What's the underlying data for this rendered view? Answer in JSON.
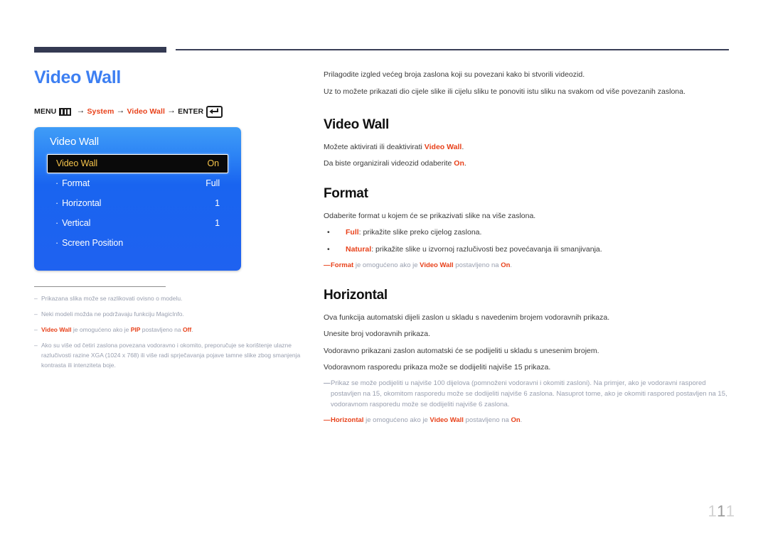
{
  "page": {
    "title": "Video Wall",
    "number": "111",
    "number_digits": [
      "1",
      "1",
      "1"
    ]
  },
  "colors": {
    "title_blue": "#3d7ff2",
    "accent_red": "#e8411a",
    "osd_blue": "#1964f0",
    "osd_highlight_text": "#f5c34a",
    "rule_dark": "#343a52",
    "note_gray": "#9aa0b0"
  },
  "menu_path": {
    "menu_label": "MENU",
    "menu_icon": "menu-bars-icon",
    "arrow": "→",
    "step1": "System",
    "step2": "Video Wall",
    "enter_label": "ENTER",
    "enter_icon": "enter-return-icon"
  },
  "osd": {
    "title": "Video Wall",
    "rows": [
      {
        "bullet": "",
        "label": "Video Wall",
        "value": "On",
        "highlighted": true
      },
      {
        "bullet": "·",
        "label": "Format",
        "value": "Full",
        "highlighted": false
      },
      {
        "bullet": "·",
        "label": "Horizontal",
        "value": "1",
        "highlighted": false
      },
      {
        "bullet": "·",
        "label": "Vertical",
        "value": "1",
        "highlighted": false
      },
      {
        "bullet": "·",
        "label": "Screen Position",
        "value": "",
        "highlighted": false
      }
    ]
  },
  "left_footnotes": {
    "dash": "–",
    "items": [
      {
        "segments": [
          {
            "t": "Prikazana slika može se razlikovati ovisno o modelu.",
            "red": false
          }
        ]
      },
      {
        "segments": [
          {
            "t": "Neki modeli možda ne podržavaju funkciju MagicInfo.",
            "red": false
          }
        ]
      },
      {
        "segments": [
          {
            "t": "Video Wall",
            "red": true
          },
          {
            "t": " je omogućeno ako je ",
            "red": false
          },
          {
            "t": "PIP",
            "red": true
          },
          {
            "t": " postavljeno na ",
            "red": false
          },
          {
            "t": "Off",
            "red": true
          },
          {
            "t": ".",
            "red": false
          }
        ]
      },
      {
        "segments": [
          {
            "t": "Ako su više od četiri zaslona povezana vodoravno i okomito, preporučuje se korištenje ulazne razlučivosti razine XGA (1024 x 768) ili više radi sprječavanja pojave tamne slike zbog smanjenja kontrasta ili intenziteta boje.",
            "red": false
          }
        ]
      }
    ]
  },
  "content": {
    "intro": [
      "Prilagodite izgled većeg broja zaslona koji su povezani kako bi stvorili videozid.",
      "Uz to možete prikazati dio cijele slike ili cijelu sliku te ponoviti istu sliku na svakom od više povezanih zaslona."
    ],
    "sections": [
      {
        "heading": "Video Wall",
        "lines": [
          [
            {
              "t": "Možete aktivirati ili deaktivirati ",
              "red": false
            },
            {
              "t": "Video Wall",
              "red": true
            },
            {
              "t": ".",
              "red": false
            }
          ],
          [
            {
              "t": "Da biste organizirali videozid odaberite ",
              "red": false
            },
            {
              "t": "On",
              "red": true
            },
            {
              "t": ".",
              "red": false
            }
          ]
        ],
        "bullets": [],
        "notes": []
      },
      {
        "heading": "Format",
        "lines": [
          [
            {
              "t": "Odaberite format u kojem će se prikazivati slike na više zaslona.",
              "red": false
            }
          ]
        ],
        "bullets": [
          {
            "dot": "•",
            "segments": [
              {
                "t": "Full",
                "red": true
              },
              {
                "t": ": prikažite slike preko cijelog zaslona.",
                "red": false
              }
            ]
          },
          {
            "dot": "•",
            "segments": [
              {
                "t": "Natural",
                "red": true
              },
              {
                "t": ": prikažite slike u izvornoj razlučivosti bez povećavanja ili smanjivanja.",
                "red": false
              }
            ]
          }
        ],
        "notes": [
          {
            "dash": "—",
            "dash_red": true,
            "segments": [
              {
                "t": "Format",
                "red": true
              },
              {
                "t": " je omogućeno ako je ",
                "red": false
              },
              {
                "t": "Video Wall",
                "red": true
              },
              {
                "t": " postavljeno na ",
                "red": false
              },
              {
                "t": "On",
                "red": true
              },
              {
                "t": ".",
                "red": false
              }
            ]
          }
        ]
      },
      {
        "heading": "Horizontal",
        "lines": [
          [
            {
              "t": "Ova funkcija automatski dijeli zaslon u skladu s navedenim brojem vodoravnih prikaza.",
              "red": false
            }
          ],
          [
            {
              "t": "Unesite broj vodoravnih prikaza.",
              "red": false
            }
          ],
          [
            {
              "t": "Vodoravno prikazani zaslon automatski će se podijeliti u skladu s unesenim brojem.",
              "red": false
            }
          ],
          [
            {
              "t": "Vodoravnom rasporedu prikaza može se dodijeliti najviše 15 prikaza.",
              "red": false
            }
          ]
        ],
        "bullets": [],
        "notes": [
          {
            "dash": "—",
            "dash_red": false,
            "segments": [
              {
                "t": "Prikaz se može podijeliti u najviše 100 dijelova (pomnoženi vodoravni i okomiti zasloni). Na primjer, ako je vodoravni raspored postavljen na 15, okomitom rasporedu može se dodijeliti najviše 6 zaslona. Nasuprot tome, ako je okomiti raspored postavljen na 15, vodoravnom rasporedu može se dodijeliti najviše 6 zaslona.",
                "red": false
              }
            ]
          },
          {
            "dash": "—",
            "dash_red": true,
            "segments": [
              {
                "t": "Horizontal",
                "red": true
              },
              {
                "t": " je omogućeno ako je ",
                "red": false
              },
              {
                "t": "Video Wall",
                "red": true
              },
              {
                "t": " postavljeno na ",
                "red": false
              },
              {
                "t": "On",
                "red": true
              },
              {
                "t": ".",
                "red": false
              }
            ]
          }
        ]
      }
    ]
  }
}
